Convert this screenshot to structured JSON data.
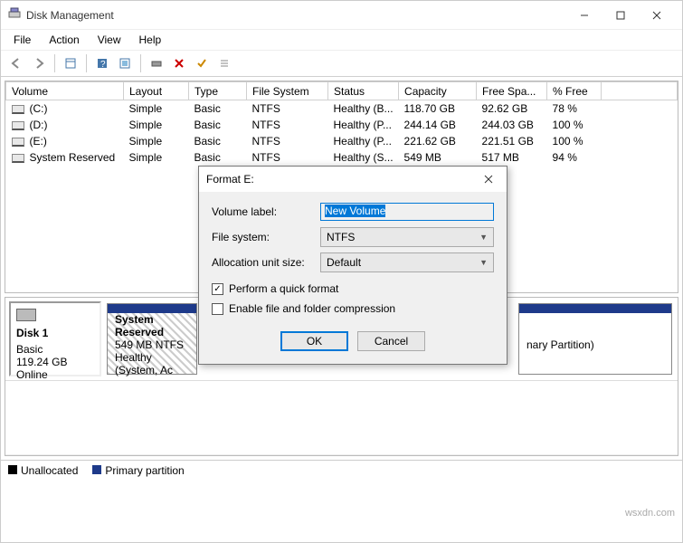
{
  "window": {
    "title": "Disk Management",
    "icon": "disk-mgmt-icon",
    "menubar": [
      "File",
      "Action",
      "View",
      "Help"
    ]
  },
  "toolbar": [
    {
      "name": "back-icon"
    },
    {
      "name": "forward-icon"
    },
    {
      "sep": true
    },
    {
      "name": "show-icon"
    },
    {
      "sep": true
    },
    {
      "name": "help-icon"
    },
    {
      "name": "refresh-icon"
    },
    {
      "sep": true
    },
    {
      "name": "settings-icon"
    },
    {
      "name": "delete-icon"
    },
    {
      "name": "check-icon"
    },
    {
      "name": "list-icon"
    }
  ],
  "columns": [
    "Volume",
    "Layout",
    "Type",
    "File System",
    "Status",
    "Capacity",
    "Free Spa...",
    "% Free"
  ],
  "volumes": [
    {
      "name": "(C:)",
      "layout": "Simple",
      "vtype": "Basic",
      "fs": "NTFS",
      "status": "Healthy (B...",
      "capacity": "118.70 GB",
      "free": "92.62 GB",
      "pct": "78 %"
    },
    {
      "name": "(D:)",
      "layout": "Simple",
      "vtype": "Basic",
      "fs": "NTFS",
      "status": "Healthy (P...",
      "capacity": "244.14 GB",
      "free": "244.03 GB",
      "pct": "100 %"
    },
    {
      "name": "(E:)",
      "layout": "Simple",
      "vtype": "Basic",
      "fs": "NTFS",
      "status": "Healthy (P...",
      "capacity": "221.62 GB",
      "free": "221.51 GB",
      "pct": "100 %"
    },
    {
      "name": "System Reserved",
      "layout": "Simple",
      "vtype": "Basic",
      "fs": "NTFS",
      "status": "Healthy (S...",
      "capacity": "549 MB",
      "free": "517 MB",
      "pct": "94 %"
    }
  ],
  "disk": {
    "name": "Disk 1",
    "type": "Basic",
    "size": "119.24 GB",
    "status": "Online"
  },
  "partitions": [
    {
      "title": "System Reserved",
      "line2": "549 MB NTFS",
      "line3": "Healthy (System, Ac",
      "stripe": "#1e3a8a",
      "hatched": true,
      "width": 100
    },
    {
      "title": "",
      "line2": "",
      "line3": "nary Partition)",
      "stripe": "#1e3a8a",
      "hatched": false,
      "width": 170
    }
  ],
  "legend": [
    {
      "color": "#000000",
      "label": "Unallocated"
    },
    {
      "color": "#1e3a8a",
      "label": "Primary partition"
    }
  ],
  "dialog": {
    "title": "Format E:",
    "labels": {
      "volume": "Volume label:",
      "fs": "File system:",
      "unit": "Allocation unit size:"
    },
    "values": {
      "volume": "New Volume",
      "fs": "NTFS",
      "unit": "Default"
    },
    "checkboxes": {
      "quick": {
        "label": "Perform a quick format",
        "checked": true
      },
      "compress": {
        "label": "Enable file and folder compression",
        "checked": false
      }
    },
    "buttons": {
      "ok": "OK",
      "cancel": "Cancel"
    }
  },
  "watermark": "wsxdn.com"
}
